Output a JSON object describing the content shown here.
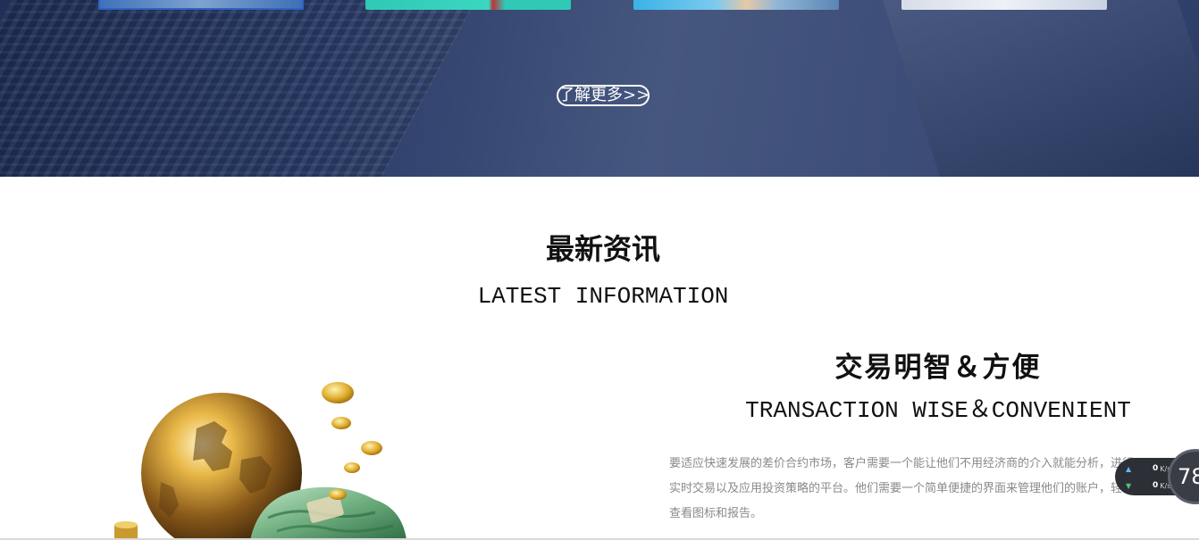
{
  "hero": {
    "more_label": "了解更多>>"
  },
  "news": {
    "title": "最新资讯",
    "subtitle": "LATEST INFORMATION"
  },
  "feature": {
    "title": "交易明智＆方便",
    "subtitle": "TRANSACTION WISE＆CONVENIENT",
    "description": "要适应快速发展的差价合约市场，客户需要一个能让他们不用经济商的介入就能分析，进行实时交易以及应用投资策略的平台。他们需要一个简单便捷的界面来管理他们的账户，轻松查看图标和报告。"
  },
  "speed_widget": {
    "upload_value": "0",
    "upload_unit": "K/s",
    "download_value": "0",
    "download_unit": "K/s",
    "dial_value": "78"
  },
  "colors": {
    "hero_bg": "#2b3d69",
    "text_dark": "#111111",
    "text_muted": "#8a8a8a",
    "upload_arrow": "#5ab8f3",
    "download_arrow": "#4fc37a"
  }
}
